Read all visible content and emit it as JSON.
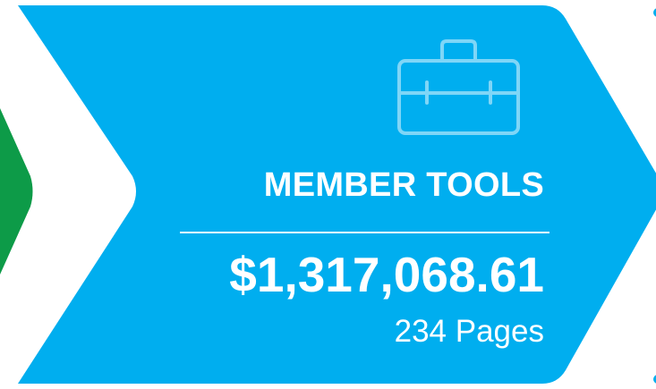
{
  "card": {
    "category_label": "MEMBER TOOLS",
    "amount": "$1,317,068.61",
    "pages": "234 Pages",
    "icon": "briefcase-icon"
  },
  "colors": {
    "card_background": "#00aeef",
    "previous_card": "#0d9b48",
    "icon_stroke": "#7fd6f7",
    "text": "#ffffff",
    "page_background": "#ffffff"
  }
}
